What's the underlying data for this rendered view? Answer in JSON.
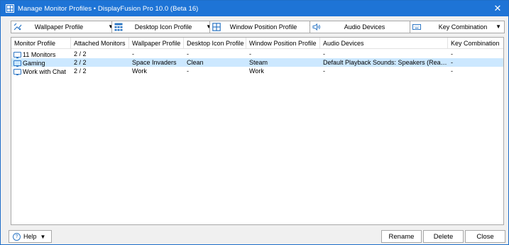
{
  "window": {
    "title": "Manage Monitor Profiles • DisplayFusion Pro 10.0 (Beta 16)",
    "close_glyph": "✕",
    "accent_color": "#1e74d6"
  },
  "toolbar": {
    "items": [
      {
        "label": "Wallpaper Profile",
        "icon": "wallpaper-icon"
      },
      {
        "label": "Desktop Icon Profile",
        "icon": "desktop-icons-icon"
      },
      {
        "label": "Window Position Profile",
        "icon": "window-position-icon"
      },
      {
        "label": "Audio Devices",
        "icon": "speaker-icon"
      },
      {
        "label": "Key Combination",
        "icon": "keyboard-icon"
      }
    ],
    "arrow": "▼"
  },
  "table": {
    "columns": [
      "Monitor Profile",
      "Attached Monitors",
      "Wallpaper Profile",
      "Desktop Icon Profile",
      "Window Position Profile",
      "Audio Devices",
      "Key Combination"
    ],
    "rows": [
      {
        "cells": [
          "11 Monitors",
          "2 / 2",
          "-",
          "-",
          "-",
          "-",
          "-"
        ],
        "selected": false
      },
      {
        "cells": [
          "Gaming",
          "2 / 2",
          "Space Invaders",
          "Clean",
          "Steam",
          "Default Playback Sounds: Speakers (Realtek(R) ...",
          "-"
        ],
        "selected": true
      },
      {
        "cells": [
          "Work with Chat",
          "2 / 2",
          "Work",
          "-",
          "Work",
          "-",
          "-"
        ],
        "selected": false
      }
    ],
    "selected_color": "#cce8ff"
  },
  "footer": {
    "help_label": "Help",
    "help_glyph": "?",
    "help_arrow": "▼",
    "rename_label": "Rename",
    "delete_label": "Delete",
    "close_label": "Close"
  }
}
